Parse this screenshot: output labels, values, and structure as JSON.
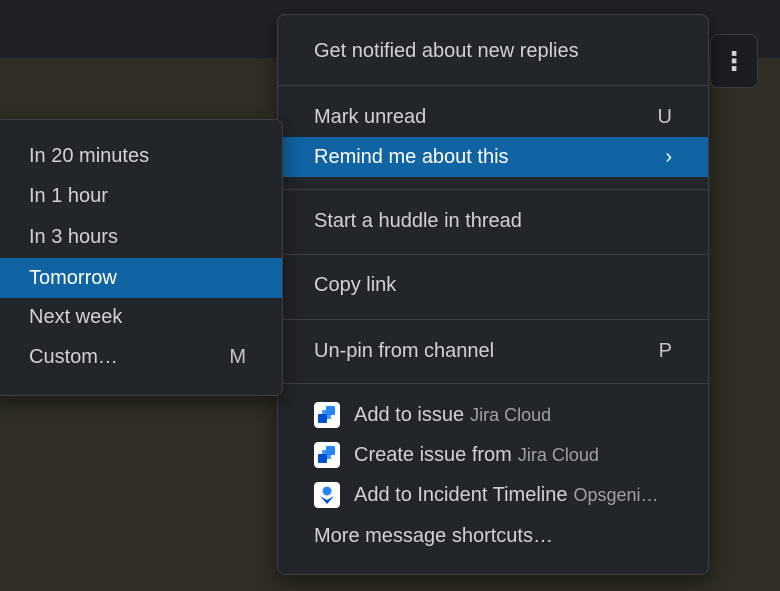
{
  "main_menu": {
    "notify": "Get notified about new replies",
    "mark_unread": {
      "label": "Mark unread",
      "shortcut": "U"
    },
    "remind": {
      "label": "Remind me about this",
      "chevron": "›"
    },
    "huddle": "Start a huddle in thread",
    "copy_link": "Copy link",
    "unpin": {
      "label": "Un-pin from channel",
      "shortcut": "P"
    },
    "add_to_issue": {
      "label": "Add to issue",
      "source": "Jira Cloud"
    },
    "create_issue": {
      "label": "Create issue from",
      "source": "Jira Cloud"
    },
    "incident": {
      "label": "Add to Incident Timeline",
      "source": "Opsgeni…"
    },
    "more": "More message shortcuts…"
  },
  "remind_submenu": {
    "items": [
      "In 20 minutes",
      "In 1 hour",
      "In 3 hours",
      "Tomorrow",
      "Next week"
    ],
    "custom": {
      "label": "Custom…",
      "shortcut": "M"
    }
  },
  "kebab": "⋮",
  "colors": {
    "highlight": "#1164a3",
    "menu_bg": "#222529",
    "jira_blue": "#2684ff",
    "opsgenie_blue": "#2684ff"
  }
}
